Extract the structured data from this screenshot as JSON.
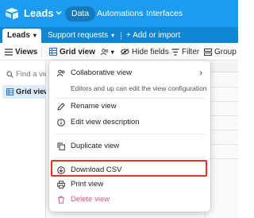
{
  "app": {
    "title": "Leads",
    "nav_tabs": [
      "Data",
      "Automations",
      "Interfaces"
    ],
    "accent_color": "#1d9bf0",
    "tab_bar_color": "#0e86d4"
  },
  "tables": {
    "active": "Leads",
    "items": [
      "Support requests"
    ],
    "add_label": "+ Add or import"
  },
  "toolbar": {
    "views": "Views",
    "grid_view": "Grid view",
    "hide_fields": "Hide fields",
    "filter": "Filter",
    "group": "Group"
  },
  "sidebar": {
    "find_placeholder": "Find a view",
    "active_view": "Grid view"
  },
  "menu": {
    "collaborative_title": "Collaborative view",
    "collaborative_sub": "Editors and up can edit the view configuration",
    "rename": "Rename view",
    "edit_description": "Edit view description",
    "duplicate": "Duplicate view",
    "download_csv": "Download CSV",
    "print": "Print view",
    "delete": "Delete view",
    "highlight_color": "#e8302a",
    "delete_color": "#e0568a"
  }
}
